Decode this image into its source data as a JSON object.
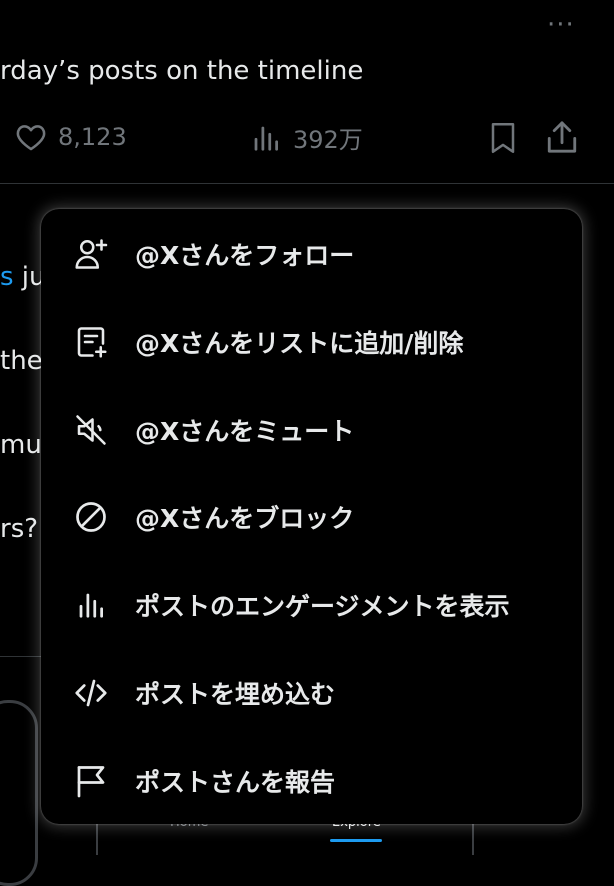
{
  "post": {
    "text_fragment": "rday’s posts on the timeline",
    "more_label": "···",
    "likes": "8,123",
    "views": "392万"
  },
  "background_fragments": [
    {
      "pre": "",
      "link": "s",
      "post": " jus"
    },
    {
      "pre": " the",
      "link": "",
      "post": ""
    },
    {
      "pre": "mu",
      "link": "",
      "post": ""
    },
    {
      "pre": "rs?",
      "link": "",
      "post": ""
    }
  ],
  "tabbar": {
    "home": "Home",
    "explore": "Explore"
  },
  "menu": {
    "items": [
      {
        "label": "@Xさんをフォロー",
        "icon": "follow-user-icon"
      },
      {
        "label": "@Xさんをリストに追加/削除",
        "icon": "list-add-icon"
      },
      {
        "label": "@Xさんをミュート",
        "icon": "mute-icon"
      },
      {
        "label": "@Xさんをブロック",
        "icon": "block-icon"
      },
      {
        "label": "ポストのエンゲージメントを表示",
        "icon": "engagement-chart-icon"
      },
      {
        "label": "ポストを埋め込む",
        "icon": "embed-code-icon"
      },
      {
        "label": "ポストさんを報告",
        "icon": "report-flag-icon"
      }
    ]
  },
  "colors": {
    "background": "#000000",
    "text": "#e7e9ea",
    "muted": "#71767b",
    "link": "#1d9bf0"
  }
}
